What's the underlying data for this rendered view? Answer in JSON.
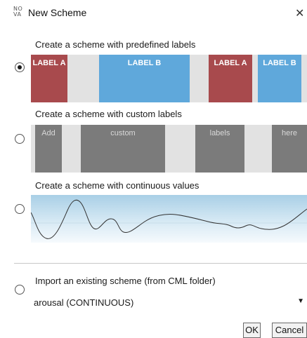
{
  "window": {
    "icon_text_top": "NO",
    "icon_text_bottom": "VA",
    "title": "New Scheme",
    "close_glyph": "✕"
  },
  "options": {
    "predefined": {
      "caption": "Create a scheme with predefined labels",
      "selected": true,
      "labels": [
        "LABEL A",
        "LABEL B",
        "LABEL A",
        "LABEL B"
      ]
    },
    "custom": {
      "caption": "Create a scheme with custom labels",
      "selected": false,
      "labels": [
        "Add",
        "custom",
        "labels",
        "here"
      ]
    },
    "continuous": {
      "caption": "Create a scheme with continuous values",
      "selected": false
    },
    "import": {
      "caption": "Import an existing scheme (from CML folder)",
      "selected": false,
      "select_value": "arousal (CONTINUOUS)"
    }
  },
  "buttons": {
    "ok": "OK",
    "cancel": "Cancel"
  },
  "colors": {
    "label_a": "#a84a4d",
    "label_b": "#5fa8db",
    "custom_label": "#7b7b7b",
    "strip_background": "#e2e2e2"
  }
}
